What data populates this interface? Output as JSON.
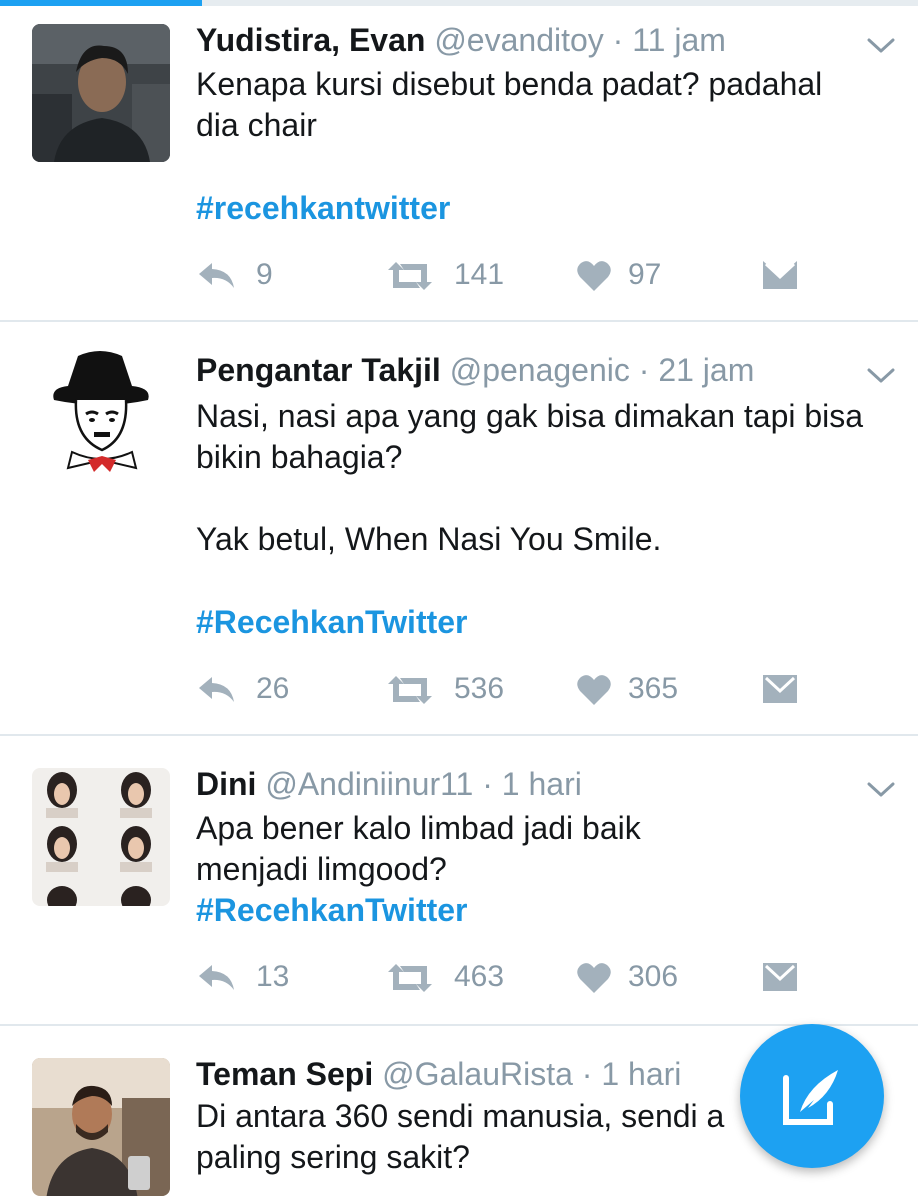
{
  "theme": {
    "accent": "#1da1f2",
    "hashtag_color": "#1b95e0",
    "muted": "#8899a6",
    "divider": "#e1e8ed"
  },
  "top_progress": {
    "fraction": 0.22
  },
  "tweets": [
    {
      "name": "Yudistira, Evan",
      "handle": "@evanditoy",
      "time": "· 11 jam",
      "avatar_icon": "profile-photo-young-man",
      "lines": [
        "Kenapa kursi disebut benda padat? padahal",
        "dia chair"
      ],
      "hashtag": "#recehkantwitter",
      "replies": "9",
      "retweets": "141",
      "likes": "97"
    },
    {
      "name": "Pengantar Takjil",
      "handle": "@penagenic",
      "time": "· 21 jam",
      "avatar_icon": "bowler-hat-cartoon",
      "lines": [
        "Nasi, nasi apa yang gak bisa dimakan tapi bisa",
        "bikin bahagia?",
        "",
        "Yak betul, When Nasi You Smile."
      ],
      "hashtag": "#RecehkanTwitter",
      "replies": "26",
      "retweets": "536",
      "likes": "365"
    },
    {
      "name": "Dini",
      "handle": "@Andiniinur11",
      "time": "· 1 hari",
      "avatar_icon": "photo-grid-woman",
      "lines": [
        "Apa bener kalo limbad jadi baik",
        "menjadi limgood?"
      ],
      "hashtag": "#RecehkanTwitter",
      "replies": "13",
      "retweets": "463",
      "likes": "306"
    },
    {
      "name": "Teman Sepi",
      "handle": "@GalauRista",
      "time": "· 1 hari",
      "avatar_icon": "profile-photo-man-beard",
      "lines": [
        "Di antara 360 sendi manusia, sendi a",
        "paling sering sakit?"
      ]
    }
  ],
  "icons": {
    "reply": "reply-icon",
    "retweet": "retweet-icon",
    "like": "heart-icon",
    "message": "envelope-icon",
    "caret": "chevron-down-icon",
    "compose": "compose-tweet-icon"
  }
}
